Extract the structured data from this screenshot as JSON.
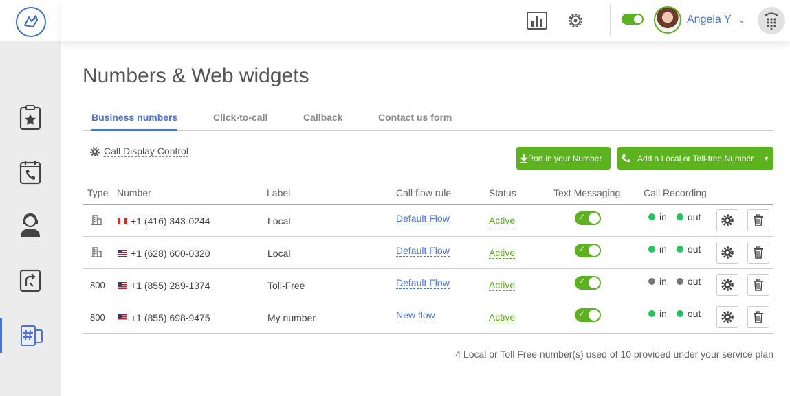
{
  "header": {
    "user_name": "Angela Y"
  },
  "page": {
    "title": "Numbers & Web widgets"
  },
  "tabs": [
    {
      "label": "Business numbers",
      "active": true
    },
    {
      "label": "Click-to-call",
      "active": false
    },
    {
      "label": "Callback",
      "active": false
    },
    {
      "label": "Contact us form",
      "active": false
    }
  ],
  "toolbar": {
    "call_display_control": "Call Display Control",
    "port_label": "Port in your Number",
    "add_label": "Add a Local or Toll-free Number"
  },
  "table": {
    "columns": [
      "Type",
      "Number",
      "Label",
      "Call flow rule",
      "Status",
      "Text Messaging",
      "Call Recording"
    ],
    "rows": [
      {
        "type": "building",
        "type_text": "",
        "flag": "ca",
        "number": "+1 (416) 343-0244",
        "label": "Local",
        "flow": "Default Flow",
        "status": "Active",
        "texting": true,
        "rec_in": true,
        "rec_out": true,
        "in_label": "in",
        "out_label": "out"
      },
      {
        "type": "building",
        "type_text": "",
        "flag": "us",
        "number": "+1 (628) 600-0320",
        "label": "Local",
        "flow": "Default Flow",
        "status": "Active",
        "texting": true,
        "rec_in": true,
        "rec_out": true,
        "in_label": "in",
        "out_label": "out"
      },
      {
        "type": "800",
        "type_text": "800",
        "flag": "us",
        "number": "+1 (855) 289-1374",
        "label": "Toll-Free",
        "flow": "Default Flow",
        "status": "Active",
        "texting": true,
        "rec_in": false,
        "rec_out": false,
        "in_label": "in",
        "out_label": "out"
      },
      {
        "type": "800",
        "type_text": "800",
        "flag": "us",
        "number": "+1 (855) 698-9475",
        "label": "My number",
        "flow": "New flow",
        "status": "Active",
        "texting": true,
        "rec_in": true,
        "rec_out": true,
        "in_label": "in",
        "out_label": "out"
      }
    ]
  },
  "footer": {
    "usage_note": "4 Local or Toll Free number(s) used of 10 provided under your service plan"
  },
  "colors": {
    "accent": "#4a74d6",
    "green": "#5db31f",
    "rec_on": "#22c55e",
    "rec_off": "#777777"
  }
}
